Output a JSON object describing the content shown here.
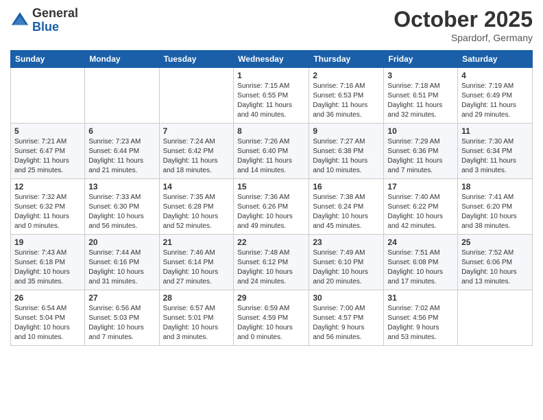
{
  "header": {
    "logo_general": "General",
    "logo_blue": "Blue",
    "month": "October 2025",
    "location": "Spardorf, Germany"
  },
  "weekdays": [
    "Sunday",
    "Monday",
    "Tuesday",
    "Wednesday",
    "Thursday",
    "Friday",
    "Saturday"
  ],
  "weeks": [
    [
      {
        "day": "",
        "info": ""
      },
      {
        "day": "",
        "info": ""
      },
      {
        "day": "",
        "info": ""
      },
      {
        "day": "1",
        "info": "Sunrise: 7:15 AM\nSunset: 6:55 PM\nDaylight: 11 hours\nand 40 minutes."
      },
      {
        "day": "2",
        "info": "Sunrise: 7:16 AM\nSunset: 6:53 PM\nDaylight: 11 hours\nand 36 minutes."
      },
      {
        "day": "3",
        "info": "Sunrise: 7:18 AM\nSunset: 6:51 PM\nDaylight: 11 hours\nand 32 minutes."
      },
      {
        "day": "4",
        "info": "Sunrise: 7:19 AM\nSunset: 6:49 PM\nDaylight: 11 hours\nand 29 minutes."
      }
    ],
    [
      {
        "day": "5",
        "info": "Sunrise: 7:21 AM\nSunset: 6:47 PM\nDaylight: 11 hours\nand 25 minutes."
      },
      {
        "day": "6",
        "info": "Sunrise: 7:23 AM\nSunset: 6:44 PM\nDaylight: 11 hours\nand 21 minutes."
      },
      {
        "day": "7",
        "info": "Sunrise: 7:24 AM\nSunset: 6:42 PM\nDaylight: 11 hours\nand 18 minutes."
      },
      {
        "day": "8",
        "info": "Sunrise: 7:26 AM\nSunset: 6:40 PM\nDaylight: 11 hours\nand 14 minutes."
      },
      {
        "day": "9",
        "info": "Sunrise: 7:27 AM\nSunset: 6:38 PM\nDaylight: 11 hours\nand 10 minutes."
      },
      {
        "day": "10",
        "info": "Sunrise: 7:29 AM\nSunset: 6:36 PM\nDaylight: 11 hours\nand 7 minutes."
      },
      {
        "day": "11",
        "info": "Sunrise: 7:30 AM\nSunset: 6:34 PM\nDaylight: 11 hours\nand 3 minutes."
      }
    ],
    [
      {
        "day": "12",
        "info": "Sunrise: 7:32 AM\nSunset: 6:32 PM\nDaylight: 11 hours\nand 0 minutes."
      },
      {
        "day": "13",
        "info": "Sunrise: 7:33 AM\nSunset: 6:30 PM\nDaylight: 10 hours\nand 56 minutes."
      },
      {
        "day": "14",
        "info": "Sunrise: 7:35 AM\nSunset: 6:28 PM\nDaylight: 10 hours\nand 52 minutes."
      },
      {
        "day": "15",
        "info": "Sunrise: 7:36 AM\nSunset: 6:26 PM\nDaylight: 10 hours\nand 49 minutes."
      },
      {
        "day": "16",
        "info": "Sunrise: 7:38 AM\nSunset: 6:24 PM\nDaylight: 10 hours\nand 45 minutes."
      },
      {
        "day": "17",
        "info": "Sunrise: 7:40 AM\nSunset: 6:22 PM\nDaylight: 10 hours\nand 42 minutes."
      },
      {
        "day": "18",
        "info": "Sunrise: 7:41 AM\nSunset: 6:20 PM\nDaylight: 10 hours\nand 38 minutes."
      }
    ],
    [
      {
        "day": "19",
        "info": "Sunrise: 7:43 AM\nSunset: 6:18 PM\nDaylight: 10 hours\nand 35 minutes."
      },
      {
        "day": "20",
        "info": "Sunrise: 7:44 AM\nSunset: 6:16 PM\nDaylight: 10 hours\nand 31 minutes."
      },
      {
        "day": "21",
        "info": "Sunrise: 7:46 AM\nSunset: 6:14 PM\nDaylight: 10 hours\nand 27 minutes."
      },
      {
        "day": "22",
        "info": "Sunrise: 7:48 AM\nSunset: 6:12 PM\nDaylight: 10 hours\nand 24 minutes."
      },
      {
        "day": "23",
        "info": "Sunrise: 7:49 AM\nSunset: 6:10 PM\nDaylight: 10 hours\nand 20 minutes."
      },
      {
        "day": "24",
        "info": "Sunrise: 7:51 AM\nSunset: 6:08 PM\nDaylight: 10 hours\nand 17 minutes."
      },
      {
        "day": "25",
        "info": "Sunrise: 7:52 AM\nSunset: 6:06 PM\nDaylight: 10 hours\nand 13 minutes."
      }
    ],
    [
      {
        "day": "26",
        "info": "Sunrise: 6:54 AM\nSunset: 5:04 PM\nDaylight: 10 hours\nand 10 minutes."
      },
      {
        "day": "27",
        "info": "Sunrise: 6:56 AM\nSunset: 5:03 PM\nDaylight: 10 hours\nand 7 minutes."
      },
      {
        "day": "28",
        "info": "Sunrise: 6:57 AM\nSunset: 5:01 PM\nDaylight: 10 hours\nand 3 minutes."
      },
      {
        "day": "29",
        "info": "Sunrise: 6:59 AM\nSunset: 4:59 PM\nDaylight: 10 hours\nand 0 minutes."
      },
      {
        "day": "30",
        "info": "Sunrise: 7:00 AM\nSunset: 4:57 PM\nDaylight: 9 hours\nand 56 minutes."
      },
      {
        "day": "31",
        "info": "Sunrise: 7:02 AM\nSunset: 4:56 PM\nDaylight: 9 hours\nand 53 minutes."
      },
      {
        "day": "",
        "info": ""
      }
    ]
  ]
}
